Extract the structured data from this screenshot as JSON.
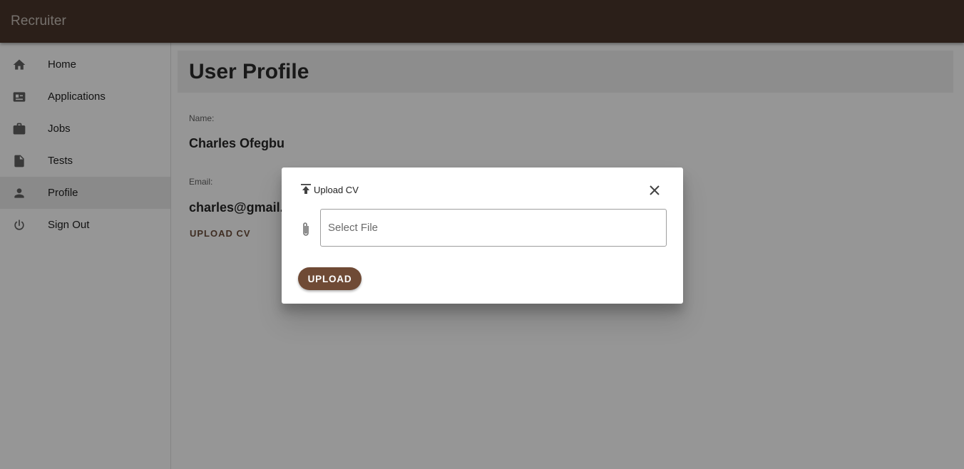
{
  "appbar": {
    "title": "Recruiter",
    "color": "#4a362b"
  },
  "sidebar": {
    "items": [
      {
        "label": "Home",
        "icon": "home-icon"
      },
      {
        "label": "Applications",
        "icon": "applications-icon"
      },
      {
        "label": "Jobs",
        "icon": "briefcase-icon"
      },
      {
        "label": "Tests",
        "icon": "document-icon"
      },
      {
        "label": "Profile",
        "icon": "person-icon",
        "active": true
      },
      {
        "label": "Sign Out",
        "icon": "power-icon"
      }
    ]
  },
  "main": {
    "title": "User Profile",
    "name_label": "Name:",
    "name_value": "Charles Ofegbu",
    "email_label": "Email:",
    "email_value": "charles@gmail.com",
    "upload_link": "UPLOAD CV"
  },
  "dialog": {
    "title": "Upload CV",
    "file_placeholder": "Select File",
    "file_value": "",
    "upload_button": "UPLOAD",
    "accent_color": "#6f4a35"
  }
}
